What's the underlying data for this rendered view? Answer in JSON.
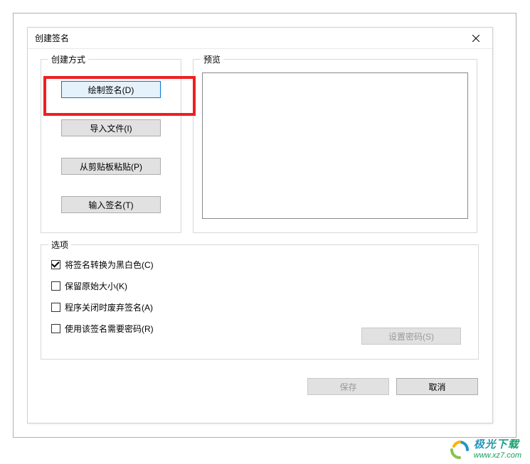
{
  "dialog": {
    "title": "创建签名"
  },
  "method": {
    "legend": "创建方式",
    "draw": "绘制签名(D)",
    "import": "导入文件(I)",
    "paste": "从剪贴板粘贴(P)",
    "type": "输入签名(T)"
  },
  "preview": {
    "legend": "预览"
  },
  "options": {
    "legend": "选项",
    "bw": "将签名转换为黑白色(C)",
    "keepsize": "保留原始大小(K)",
    "discard": "程序关闭时废弃签名(A)",
    "password": "使用该签名需要密码(R)",
    "setpassword": "设置密码(S)"
  },
  "buttons": {
    "save": "保存",
    "cancel": "取消"
  },
  "watermark": {
    "line1": "极光下载",
    "line2": "www.xz7.com"
  }
}
